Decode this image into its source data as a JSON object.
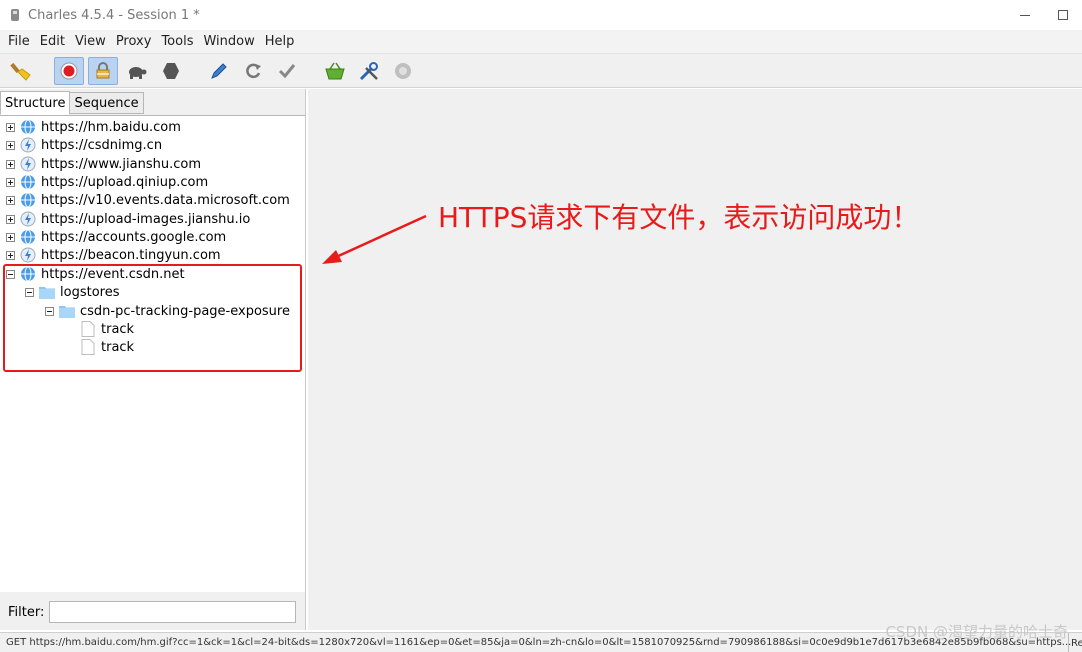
{
  "window": {
    "title": "Charles 4.5.4 - Session 1 *"
  },
  "menu": [
    "File",
    "Edit",
    "View",
    "Proxy",
    "Tools",
    "Window",
    "Help"
  ],
  "toolbar": {
    "icons": [
      "broom-icon",
      "record-icon",
      "ssl-proxy-lock-icon",
      "throttle-turtle-icon",
      "breakpoint-hexagon-icon",
      "compose-pen-icon",
      "repeat-icon",
      "validate-check-icon",
      "basket-icon",
      "tools-icon",
      "settings-gear-icon"
    ]
  },
  "tabs": {
    "structure": "Structure",
    "sequence": "Sequence"
  },
  "tree": {
    "hosts": [
      {
        "label": "https://hm.baidu.com",
        "icon": "globe-icon"
      },
      {
        "label": "https://csdnimg.cn",
        "icon": "lightning-icon"
      },
      {
        "label": "https://www.jianshu.com",
        "icon": "lightning-icon"
      },
      {
        "label": "https://upload.qiniup.com",
        "icon": "globe-icon"
      },
      {
        "label": "https://v10.events.data.microsoft.com",
        "icon": "globe-icon"
      },
      {
        "label": "https://upload-images.jianshu.io",
        "icon": "lightning-icon"
      },
      {
        "label": "https://accounts.google.com",
        "icon": "globe-icon"
      },
      {
        "label": "https://beacon.tingyun.com",
        "icon": "lightning-icon"
      },
      {
        "label": "https://event.csdn.net",
        "icon": "globe-icon"
      }
    ],
    "folder1": "logstores",
    "folder2": "csdn-pc-tracking-page-exposure",
    "file1": "track",
    "file2": "track"
  },
  "filter": {
    "label": "Filter:",
    "value": ""
  },
  "status": {
    "text": "GET https://hm.baidu.com/hm.gif?cc=1&ck=1&cl=24-bit&ds=1280x720&vl=1161&ep=0&et=85&ja=0&ln=zh-cn&lo=0&lt=1581070925&rnd=790986188&si=0c0e9d9b1e7d617b3e6842e85b9fb068&su=https...",
    "right": "Re"
  },
  "annotation": {
    "text": "HTTPS请求下有文件，表示访问成功！",
    "color": "#e81b1b"
  },
  "watermark": "CSDN @渴望力量的哈士奇"
}
